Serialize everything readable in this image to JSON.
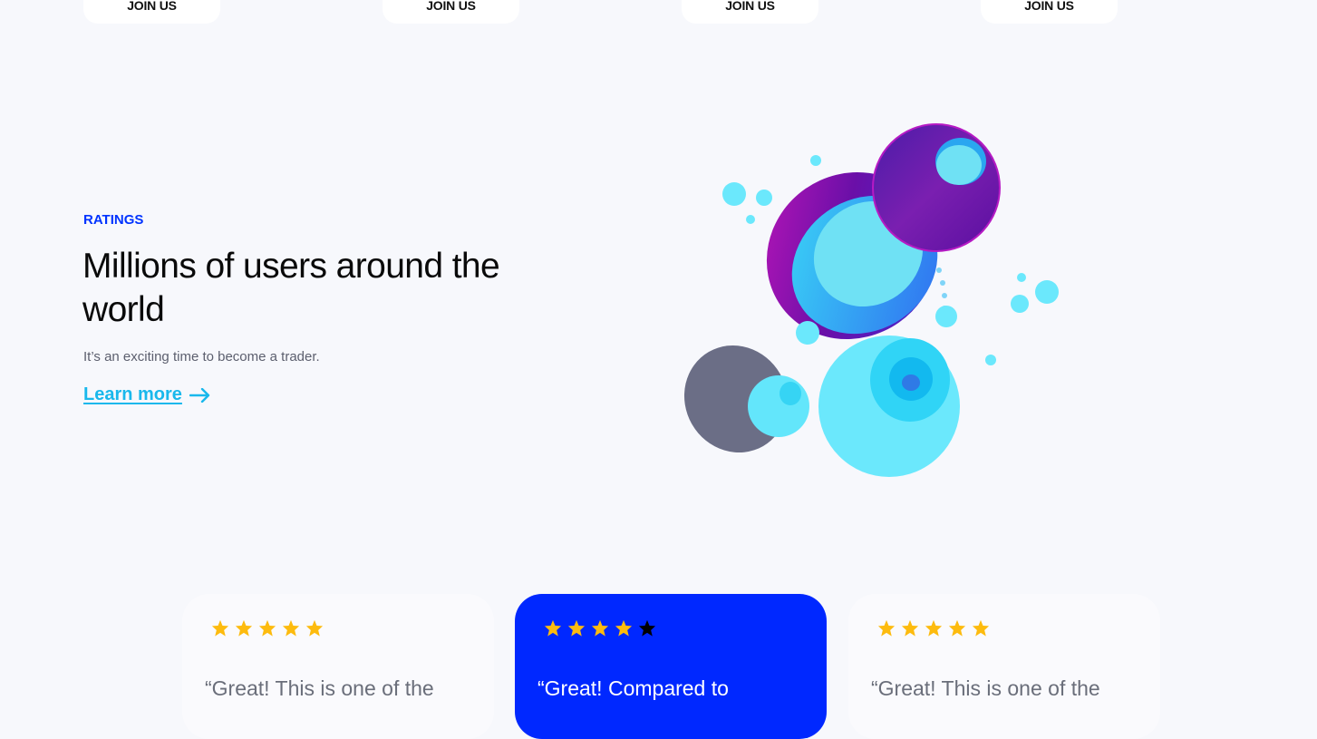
{
  "top_buttons": [
    {
      "label": "JOIN US"
    },
    {
      "label": "JOIN US"
    },
    {
      "label": "JOIN US"
    },
    {
      "label": "JOIN US"
    }
  ],
  "ratings_section": {
    "eyebrow": "RATINGS",
    "headline": "Millions of users around the world",
    "subtext": "It’s an exciting time to become a trader.",
    "learn_more_label": "Learn more",
    "learn_more_icon": "arrow-right-icon"
  },
  "reviews": [
    {
      "stars_filled": 5,
      "stars_total": 5,
      "quote": "“Great! This is one of the"
    },
    {
      "stars_filled": 4,
      "stars_total": 5,
      "quote": "“Great! Compared to"
    },
    {
      "stars_filled": 5,
      "stars_total": 5,
      "quote": "“Great! This is one of the"
    }
  ],
  "colors": {
    "background": "#f7f8fc",
    "accent_blue": "#0033ff",
    "featured_card": "#0028ff",
    "link_cyan": "#19b8ec",
    "star_filled": "#fdbb0e",
    "star_empty": "#000000",
    "text_muted": "#6a6e7a"
  }
}
